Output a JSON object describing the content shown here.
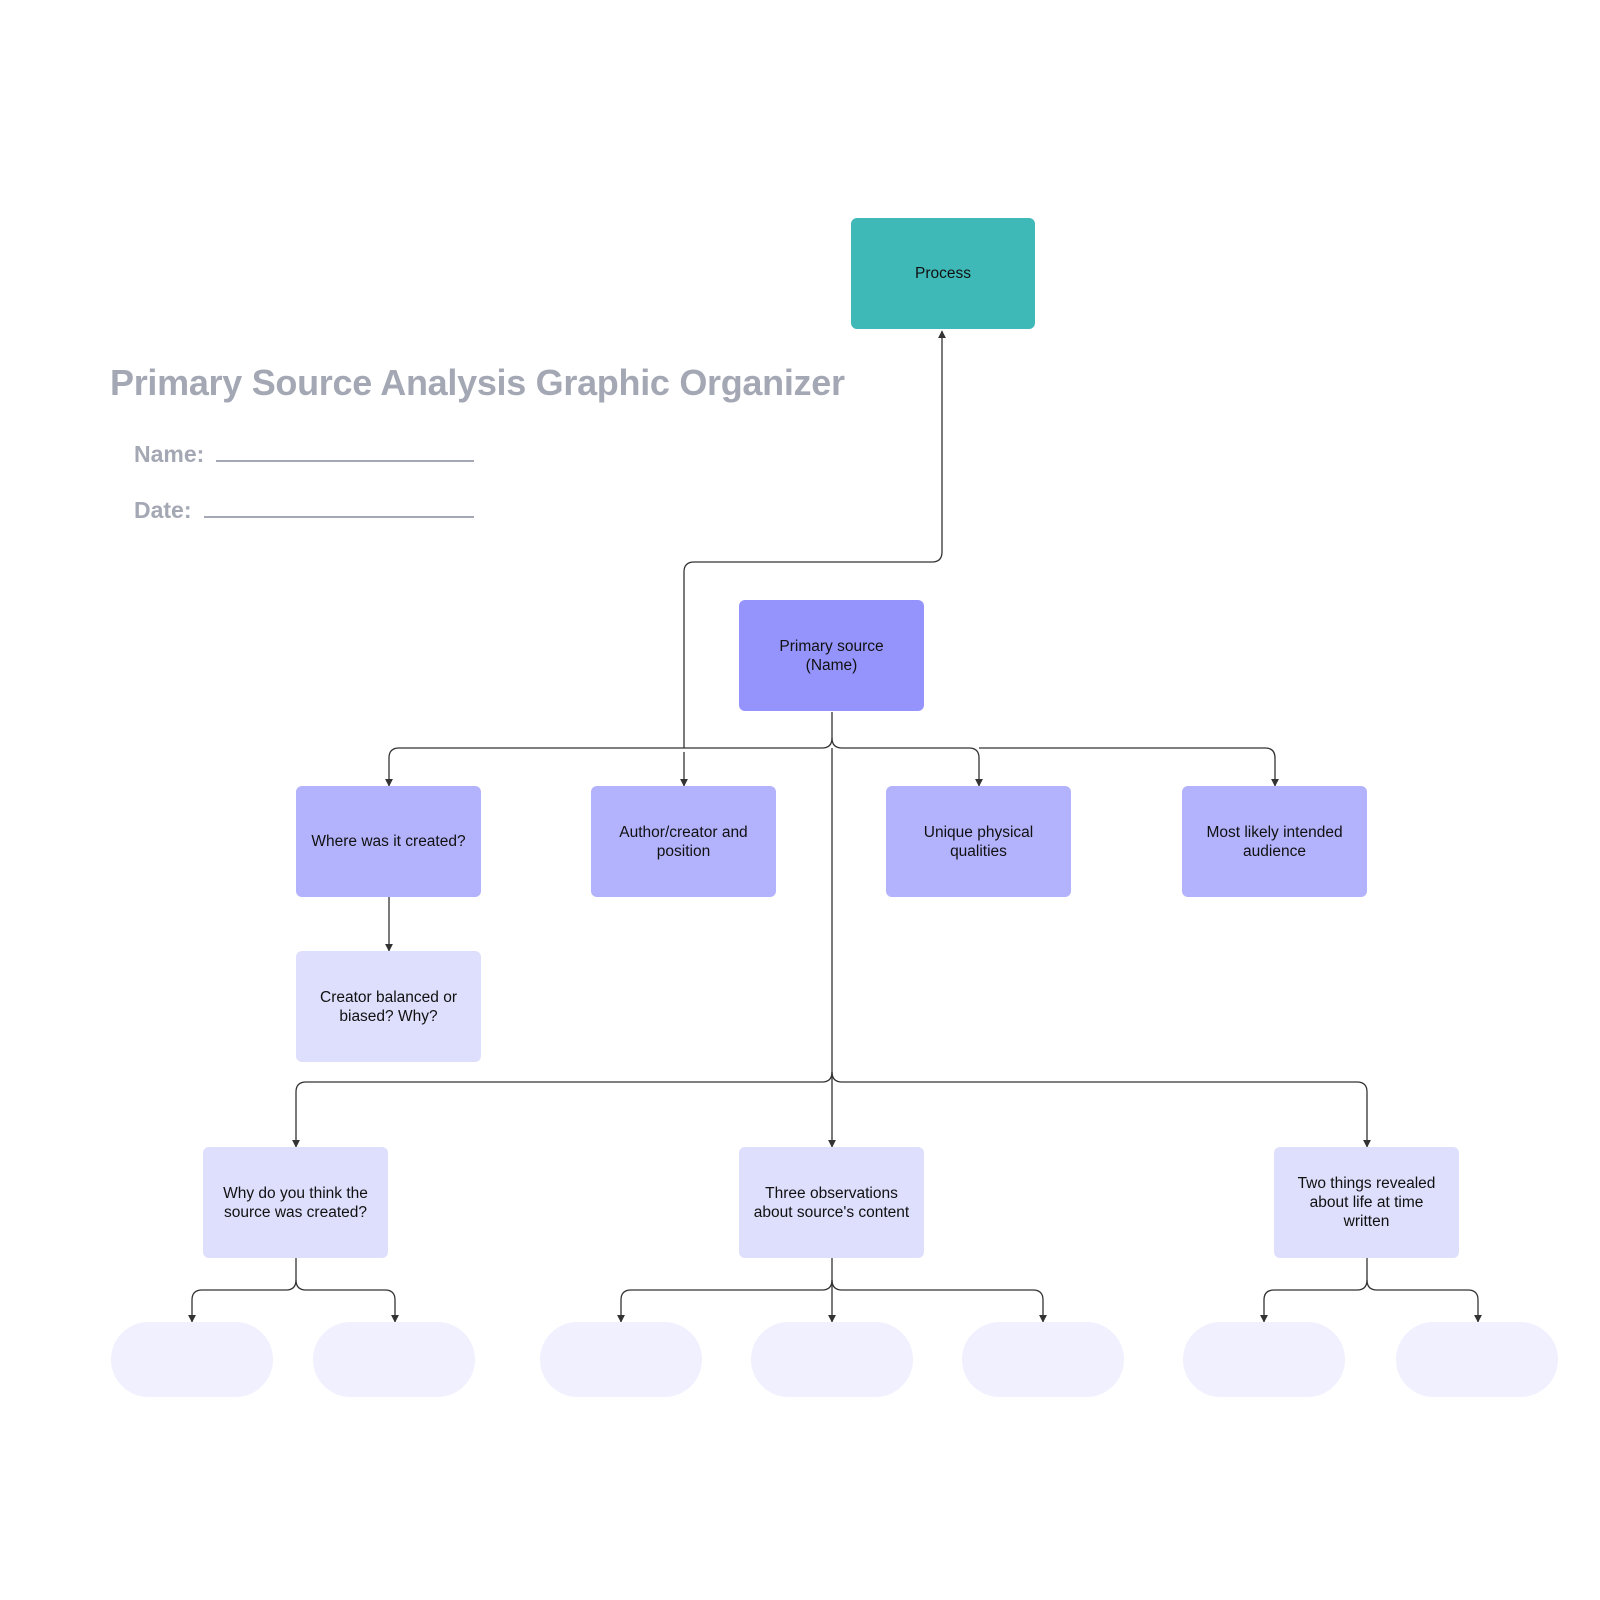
{
  "title": "Primary Source Analysis Graphic Organizer",
  "fields": {
    "name_label": "Name:",
    "date_label": "Date:"
  },
  "colors": {
    "process": "#3fb8b8",
    "primary": "#9594fd",
    "level2": "#b3b2fd",
    "level3": "#dedefd",
    "pill": "#f0f0fe",
    "connector": "#333333",
    "title_text": "#a4a8b4"
  },
  "nodes": {
    "process": "Process",
    "primary_source": "Primary source\n(Name)",
    "where_created": "Where was it created?",
    "author_creator": "Author/creator and position",
    "unique_qualities": "Unique physical qualities",
    "intended_audience": "Most likely intended audience",
    "creator_bias": "Creator balanced or biased? Why?",
    "why_created": "Why do you think the source was created?",
    "three_observations": "Three observations about source's content",
    "two_things": "Two things revealed about life at time written"
  },
  "answer_slots": [
    {
      "parent": "why_created",
      "value": ""
    },
    {
      "parent": "why_created",
      "value": ""
    },
    {
      "parent": "three_observations",
      "value": ""
    },
    {
      "parent": "three_observations",
      "value": ""
    },
    {
      "parent": "three_observations",
      "value": ""
    },
    {
      "parent": "two_things",
      "value": ""
    },
    {
      "parent": "two_things",
      "value": ""
    }
  ]
}
